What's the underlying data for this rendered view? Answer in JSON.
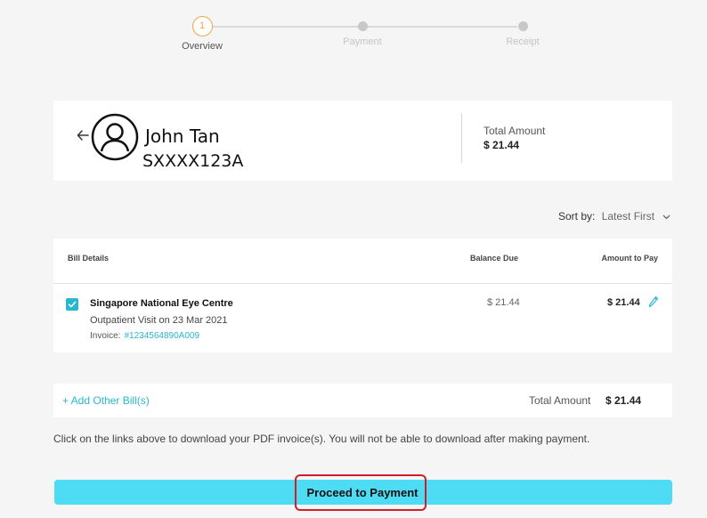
{
  "stepper": {
    "steps": [
      {
        "number": "1",
        "label": "Overview"
      },
      {
        "label": "Payment"
      },
      {
        "label": "Receipt"
      }
    ]
  },
  "patient": {
    "name": "John Tan",
    "id": "SXXXX123A",
    "total_label": "Total Amount",
    "total_value": "$ 21.44"
  },
  "sort": {
    "label": "Sort by:",
    "value": "Latest First"
  },
  "bills": {
    "headers": {
      "details": "Bill Details",
      "balance": "Balance Due",
      "amount": "Amount to Pay"
    },
    "rows": [
      {
        "checked": true,
        "provider": "Singapore National Eye Centre",
        "visit": "Outpatient Visit on 23 Mar 2021",
        "invoice_label": "Invoice:",
        "invoice_number": "#1234564890A009",
        "balance_due": "$ 21.44",
        "amount_to_pay": "$ 21.44"
      }
    ]
  },
  "summary": {
    "add_bill": "+ Add Other Bill(s)",
    "total_label": "Total Amount",
    "total_value": "$ 21.44"
  },
  "note": "Click on the links above to download your PDF invoice(s). You will not be able to download after making payment.",
  "proceed_label": "Proceed to Payment",
  "colors": {
    "accent": "#29b6d1",
    "button": "#4ddcf3",
    "step_active": "#f0a44a",
    "highlight": "#cc1f27"
  }
}
